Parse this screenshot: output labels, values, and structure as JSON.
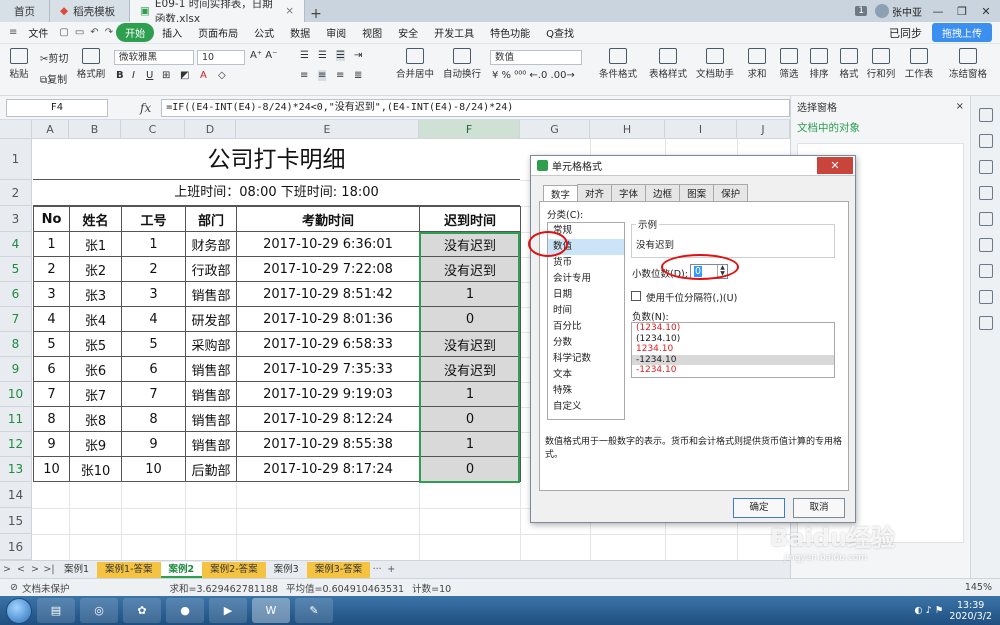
{
  "titlebar": {
    "tabs": [
      {
        "label": "首页"
      },
      {
        "label": "稻壳模板"
      },
      {
        "label": "E09-1 时间实排表，日期函数.xlsx"
      }
    ],
    "badge": "1",
    "user": "张中亚"
  },
  "menubar": {
    "file": "文件",
    "items": [
      "开始",
      "插入",
      "页面布局",
      "公式",
      "数据",
      "审阅",
      "视图",
      "安全",
      "开发工具",
      "特色功能"
    ],
    "search": "Q查找",
    "sync": "已同步",
    "upload": "拖拽上传"
  },
  "ribbon": {
    "paste": "粘贴",
    "cut": "剪切",
    "copy": "复制",
    "format_painter": "格式刷",
    "font_name": "微软雅黑",
    "font_size": "10",
    "merge": "合并居中",
    "wrap": "自动换行",
    "number_format": "数值",
    "cond_format": "条件格式",
    "table_style": "表格样式",
    "doc_helper": "文档助手",
    "sum": "求和",
    "filter": "筛选",
    "sort": "排序",
    "format": "格式",
    "rowcol": "行和列",
    "worksheet": "工作表",
    "freeze": "冻结窗格"
  },
  "formula_bar": {
    "cell_ref": "F4",
    "fx": "fx",
    "formula": "=IF((E4-INT(E4)-8/24)*24<0,\"没有迟到\",(E4-INT(E4)-8/24)*24)"
  },
  "sheet": {
    "columns": [
      "A",
      "B",
      "C",
      "D",
      "E",
      "F",
      "G",
      "H",
      "I",
      "J"
    ],
    "rows": [
      "1",
      "2",
      "3",
      "4",
      "5",
      "6",
      "7",
      "8",
      "9",
      "10",
      "11",
      "12",
      "13",
      "14",
      "15",
      "16"
    ],
    "title": "公司打卡明细",
    "subtitle": "上班时间：08:00    下班时间: 18:00",
    "headers": [
      "No",
      "姓名",
      "工号",
      "部门",
      "考勤时间",
      "迟到时间"
    ],
    "records": [
      [
        "1",
        "张1",
        "1",
        "财务部",
        "2017-10-29 6:36:01",
        "没有迟到"
      ],
      [
        "2",
        "张2",
        "2",
        "行政部",
        "2017-10-29 7:22:08",
        "没有迟到"
      ],
      [
        "3",
        "张3",
        "3",
        "销售部",
        "2017-10-29 8:51:42",
        "1"
      ],
      [
        "4",
        "张4",
        "4",
        "研发部",
        "2017-10-29 8:01:36",
        "0"
      ],
      [
        "5",
        "张5",
        "5",
        "采购部",
        "2017-10-29 6:58:33",
        "没有迟到"
      ],
      [
        "6",
        "张6",
        "6",
        "销售部",
        "2017-10-29 7:35:33",
        "没有迟到"
      ],
      [
        "7",
        "张7",
        "7",
        "销售部",
        "2017-10-29 9:19:03",
        "1"
      ],
      [
        "8",
        "张8",
        "8",
        "销售部",
        "2017-10-29 8:12:24",
        "0"
      ],
      [
        "9",
        "张9",
        "9",
        "销售部",
        "2017-10-29 8:55:38",
        "1"
      ],
      [
        "10",
        "张10",
        "10",
        "后勤部",
        "2017-10-29 8:17:24",
        "0"
      ]
    ]
  },
  "sheet_tabs": [
    "案例1",
    "案例1-答案",
    "案例2",
    "案例2-答案",
    "案例3",
    "案例3-答案"
  ],
  "status": {
    "protect": "文档未保护",
    "sum": "求和=3.629462781188",
    "avg": "平均值=0.604910463531",
    "count": "计数=10",
    "zoom": "145%"
  },
  "right_panel": {
    "header": "选择窗格",
    "title": "文档中的对象"
  },
  "dialog": {
    "title": "单元格格式",
    "tabs": [
      "数字",
      "对齐",
      "字体",
      "边框",
      "图案",
      "保护"
    ],
    "category_label": "分类(C):",
    "categories": [
      "常规",
      "数值",
      "货币",
      "会计专用",
      "日期",
      "时间",
      "百分比",
      "分数",
      "科学记数",
      "文本",
      "特殊",
      "自定义"
    ],
    "sample_label": "示例",
    "sample_value": "没有迟到",
    "decimal_label": "小数位数(D):",
    "decimal_value": "0",
    "thousands_label": "使用千位分隔符(,)(U)",
    "negative_label": "负数(N):",
    "negatives": [
      "(1234.10)",
      "(1234.10)",
      "1234.10",
      "-1234.10",
      "-1234.10"
    ],
    "description": "数值格式用于一般数字的表示。货币和会计格式则提供货币值计算的专用格式。",
    "ok": "确定",
    "cancel": "取消"
  },
  "taskbar": {
    "time": "13:39",
    "date": "2020/3/2"
  },
  "watermark": {
    "text": "Baidu经验",
    "url": "jingyan.baidu.com"
  }
}
